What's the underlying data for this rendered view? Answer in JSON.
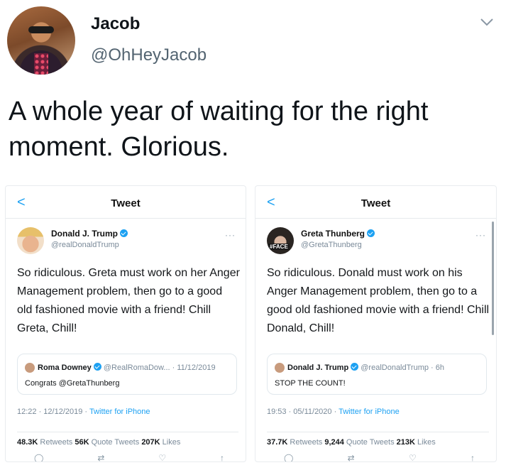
{
  "header": {
    "name": "Jacob",
    "handle": "@OhHeyJacob"
  },
  "tweet": {
    "text": "A whole year of waiting for the right moment. Glorious."
  },
  "icons": {
    "menu": "chevron-down-icon",
    "back": "back-chevron-icon",
    "verified": "verified-badge-icon"
  },
  "colors": {
    "accent": "#1da1f2",
    "secondary_text": "#536471"
  },
  "left_shot": {
    "back": "<",
    "bar_title": "Tweet",
    "name": "Donald J. Trump",
    "handle": "@realDonaldTrump",
    "more": "···",
    "body": "So ridiculous. Greta must work on her Anger Management problem, then go to a good old fashioned movie with a friend! Chill Greta, Chill!",
    "quote_name": "Roma Downey",
    "quote_handle": "@RealRomaDow... · 11/12/2019",
    "quote_text": "Congrats @GretaThunberg",
    "time": "12:22 · 12/12/2019 · ",
    "source": "Twitter for iPhone",
    "retweets": "48.3K",
    "retweets_label": " Retweets ",
    "quotes": "56K",
    "quotes_label": " Quote Tweets ",
    "likes": "207K",
    "likes_label": " Likes"
  },
  "right_shot": {
    "back": "<",
    "bar_title": "Tweet",
    "name": "Greta Thunberg",
    "handle": "@GretaThunberg",
    "badge": "#FACE",
    "more": "···",
    "body": "So ridiculous. Donald must work on his Anger Management problem, then go to a good old fashioned movie with a friend! Chill Donald, Chill!",
    "quote_name": "Donald J. Trump",
    "quote_handle": "@realDonaldTrump · 6h",
    "quote_text": "STOP THE COUNT!",
    "time": "19:53 · 05/11/2020 · ",
    "source": "Twitter for iPhone",
    "retweets": "37.7K",
    "retweets_label": " Retweets ",
    "quotes": "9,244",
    "quotes_label": " Quote Tweets ",
    "likes": "213K",
    "likes_label": " Likes"
  }
}
